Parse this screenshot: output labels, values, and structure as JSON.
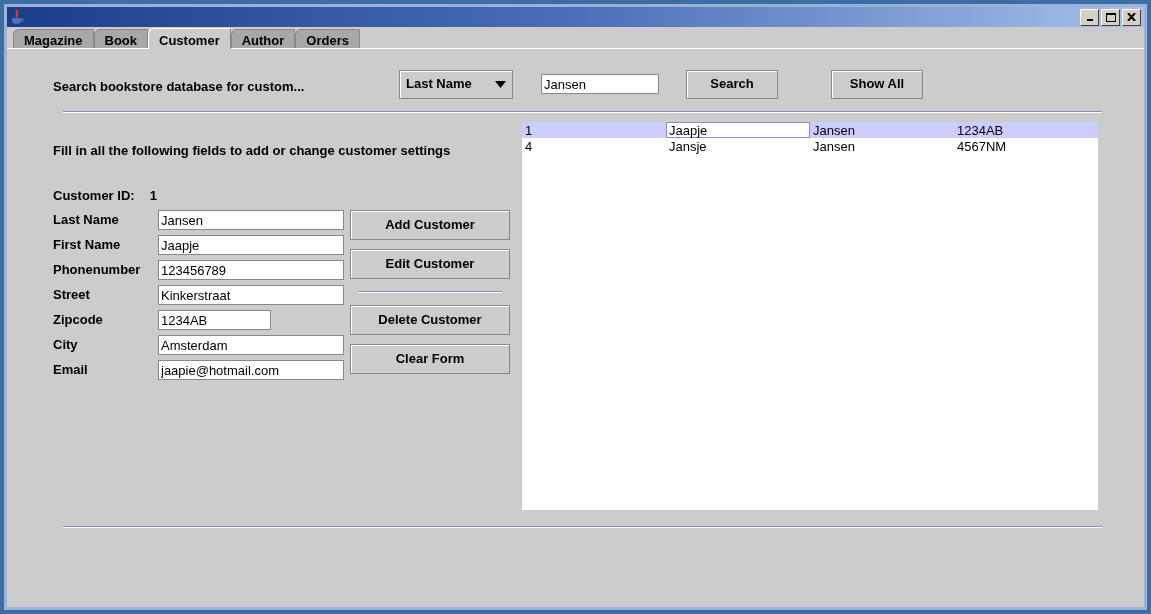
{
  "window": {
    "controls": [
      {
        "kind": "minimize"
      },
      {
        "kind": "maximize"
      },
      {
        "kind": "close"
      }
    ]
  },
  "tabs": [
    {
      "label": "Magazine",
      "selected": false
    },
    {
      "label": "Book",
      "selected": false
    },
    {
      "label": "Customer",
      "selected": true
    },
    {
      "label": "Author",
      "selected": false
    },
    {
      "label": "Orders",
      "selected": false
    }
  ],
  "search": {
    "label": "Search bookstore database for custom...",
    "field_choice": "Last Name",
    "value": "Jansen",
    "buttons": [
      "Search",
      "Show All"
    ]
  },
  "form": {
    "heading": "Fill in all the following fields to add or change customer settings",
    "id_label": "Customer ID:",
    "id_value": "1",
    "fields": [
      {
        "label": "Last Name",
        "value": "Jansen",
        "kind": "wide"
      },
      {
        "label": "First Name",
        "value": "Jaapje",
        "kind": "wide"
      },
      {
        "label": "Phonenumber",
        "value": "123456789",
        "kind": "wide"
      },
      {
        "label": "Street",
        "value": "Kinkerstraat",
        "kind": "wide"
      },
      {
        "label": "Zipcode",
        "value": "1234AB",
        "kind": "short"
      },
      {
        "label": "City",
        "value": "Amsterdam",
        "kind": "wide"
      },
      {
        "label": "Email",
        "value": "jaapie@hotmail.com",
        "kind": "wide"
      }
    ],
    "buttons": [
      {
        "label": "Add Customer",
        "kind": "button"
      },
      {
        "label": "Edit Customer",
        "kind": "button"
      },
      {
        "kind": "separator"
      },
      {
        "label": "Delete Customer",
        "kind": "button"
      },
      {
        "label": "Clear Form",
        "kind": "button"
      }
    ]
  },
  "table": {
    "rows": [
      {
        "selected": true,
        "cells": [
          {
            "text": "1",
            "focused": false
          },
          {
            "text": "Jaapje",
            "focused": true
          },
          {
            "text": "Jansen",
            "focused": false
          },
          {
            "text": "1234AB",
            "focused": false
          }
        ]
      },
      {
        "selected": false,
        "cells": [
          {
            "text": "4",
            "focused": false
          },
          {
            "text": "Jansje",
            "focused": false
          },
          {
            "text": "Jansen",
            "focused": false
          },
          {
            "text": "4567NM",
            "focused": false
          }
        ]
      }
    ]
  }
}
